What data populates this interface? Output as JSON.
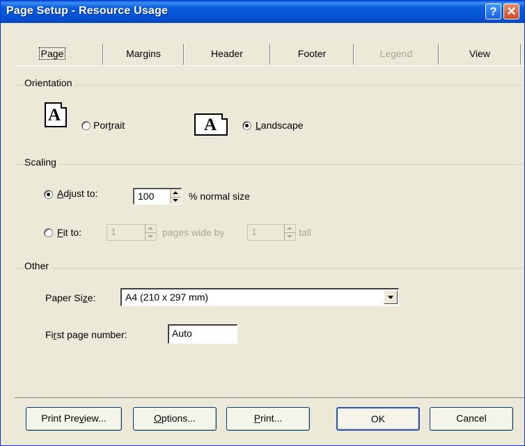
{
  "window": {
    "title": "Page Setup - Resource Usage",
    "help_glyph": "?",
    "close_glyph": "✕"
  },
  "tabs": [
    {
      "label": "Page",
      "active": true,
      "enabled": true
    },
    {
      "label": "Margins",
      "active": false,
      "enabled": true
    },
    {
      "label": "Header",
      "active": false,
      "enabled": true
    },
    {
      "label": "Footer",
      "active": false,
      "enabled": true
    },
    {
      "label": "Legend",
      "active": false,
      "enabled": false
    },
    {
      "label": "View",
      "active": false,
      "enabled": true
    }
  ],
  "orientation": {
    "group_label": "Orientation",
    "portrait": {
      "label_pre": "Por",
      "label_u": "t",
      "label_post": "rait",
      "checked": false,
      "icon": "portrait-page-icon",
      "glyph": "A"
    },
    "landscape": {
      "label_pre": "",
      "label_u": "L",
      "label_post": "andscape",
      "checked": true,
      "icon": "landscape-page-icon",
      "glyph": "A"
    }
  },
  "scaling": {
    "group_label": "Scaling",
    "adjust": {
      "label_pre": "",
      "label_u": "A",
      "label_post": "djust to:",
      "checked": true,
      "value": "100",
      "suffix": "% normal size"
    },
    "fit": {
      "label_pre": "",
      "label_u": "F",
      "label_post": "it to:",
      "checked": false,
      "wide_value": "1",
      "wide_suffix": "pages wide by",
      "tall_value": "1",
      "tall_suffix": "tall"
    }
  },
  "other": {
    "group_label": "Other",
    "paper_size": {
      "label_pre": "Paper Si",
      "label_u": "z",
      "label_post": "e:",
      "value": "A4 (210 x 297 mm)"
    },
    "first_page": {
      "label_pre": "Fi",
      "label_u": "r",
      "label_post": "st page number:",
      "value": "Auto"
    }
  },
  "buttons": {
    "print_preview": {
      "pre": "Print Pre",
      "u": "v",
      "post": "iew..."
    },
    "options": {
      "pre": "",
      "u": "O",
      "post": "ptions..."
    },
    "print": {
      "pre": "",
      "u": "P",
      "post": "rint..."
    },
    "ok": {
      "pre": "OK",
      "u": "",
      "post": ""
    },
    "cancel": {
      "pre": "Cancel",
      "u": "",
      "post": ""
    }
  }
}
